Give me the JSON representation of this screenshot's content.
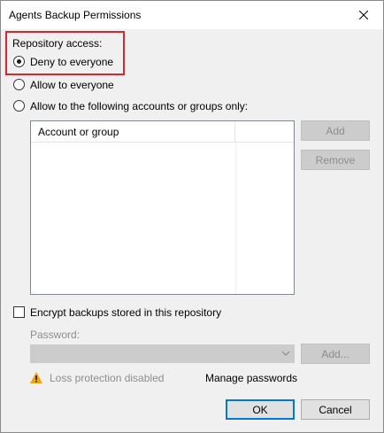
{
  "window": {
    "title": "Agents Backup Permissions"
  },
  "access": {
    "heading": "Repository access:",
    "options": [
      {
        "label": "Deny to everyone",
        "selected": true
      },
      {
        "label": "Allow to everyone",
        "selected": false
      },
      {
        "label": "Allow to the following accounts or groups only:",
        "selected": false
      }
    ]
  },
  "accounts_list": {
    "columns": [
      "Account or group",
      ""
    ],
    "rows": []
  },
  "list_buttons": {
    "add": "Add",
    "remove": "Remove"
  },
  "encryption": {
    "checkbox_label": "Encrypt backups stored in this repository",
    "checked": false,
    "password_label": "Password:",
    "password_value": "",
    "add_button": "Add...",
    "warning_text": "Loss protection disabled",
    "manage_link": "Manage passwords"
  },
  "footer": {
    "ok": "OK",
    "cancel": "Cancel"
  },
  "colors": {
    "highlight": "#d9262f",
    "default_button_border": "#0078d7",
    "warning": "#f0a30a"
  },
  "icons": {
    "close": "close-icon",
    "warning": "warning-icon",
    "dropdown": "chevron-down-icon"
  }
}
